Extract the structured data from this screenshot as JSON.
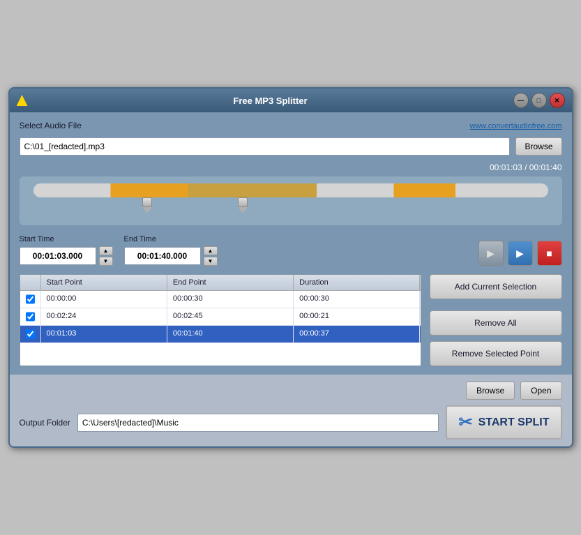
{
  "window": {
    "title": "Free MP3 Splitter"
  },
  "header": {
    "select_label": "Select Audio File",
    "website_link": "www.convertaudiofree.com",
    "file_path": "C:\\01_[redacted].mp3",
    "browse_label": "Browse"
  },
  "player": {
    "time_display": "00:01:03 / 00:01:40"
  },
  "time_controls": {
    "start_label": "Start Time",
    "start_value": "00:01:03.000",
    "end_label": "End Time",
    "end_value": "00:01:40.000"
  },
  "table": {
    "columns": [
      "",
      "Start Point",
      "End Point",
      "Duration"
    ],
    "rows": [
      {
        "checked": true,
        "start": "00:00:00",
        "end": "00:00:30",
        "duration": "00:00:30",
        "selected": false
      },
      {
        "checked": true,
        "start": "00:02:24",
        "end": "00:02:45",
        "duration": "00:00:21",
        "selected": false
      },
      {
        "checked": true,
        "start": "00:01:03",
        "end": "00:01:40",
        "duration": "00:00:37",
        "selected": true
      }
    ]
  },
  "buttons": {
    "add_current": "Add Current Selection",
    "remove_all": "Remove All",
    "remove_selected": "Remove Selected Point",
    "browse_output": "Browse",
    "open": "Open",
    "start_split": "START SPLIT"
  },
  "output": {
    "label": "Output Folder",
    "path": "C:\\Users\\[redacted]\\Music"
  },
  "icons": {
    "play_gray": "▶",
    "play_blue": "▶",
    "stop_red": "■",
    "up_arrow": "▲",
    "down_arrow": "▼",
    "scissors": "✂"
  }
}
